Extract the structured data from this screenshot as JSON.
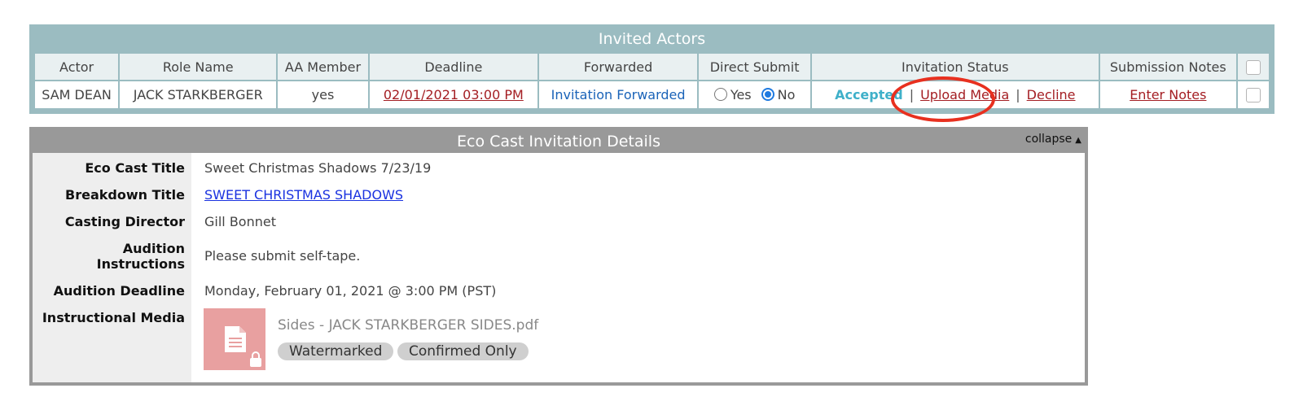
{
  "actors_panel": {
    "title": "Invited Actors",
    "headers": [
      "Actor",
      "Role Name",
      "AA Member",
      "Deadline",
      "Forwarded",
      "Direct Submit",
      "Invitation Status",
      "Submission Notes"
    ],
    "row": {
      "actor": "SAM DEAN",
      "role": "JACK STARKBERGER",
      "aa_member": "yes",
      "deadline": "02/01/2021 03:00 PM",
      "forwarded": "Invitation Forwarded",
      "direct_submit": {
        "yes_label": "Yes",
        "no_label": "No",
        "selected": "No"
      },
      "status": "Accepted",
      "upload_media": "Upload Media",
      "decline": "Decline",
      "separator": "|",
      "notes": "Enter Notes"
    }
  },
  "details_panel": {
    "title": "Eco Cast Invitation Details",
    "collapse_label": "collapse",
    "collapse_icon": "▲",
    "fields": {
      "eco_cast_title_label": "Eco Cast Title",
      "eco_cast_title_value": "Sweet Christmas Shadows 7/23/19",
      "breakdown_title_label": "Breakdown Title",
      "breakdown_title_value": "SWEET CHRISTMAS SHADOWS",
      "casting_director_label": "Casting Director",
      "casting_director_value": "Gill Bonnet",
      "audition_instructions_label_1": "Audition",
      "audition_instructions_label_2": "Instructions",
      "audition_instructions_value": "Please submit self-tape.",
      "audition_deadline_label": "Audition Deadline",
      "audition_deadline_value": "Monday, February 01, 2021 @ 3:00 PM (PST)",
      "instructional_media_label": "Instructional Media"
    },
    "media": {
      "file_name": "Sides - JACK STARKBERGER SIDES.pdf",
      "icon": "locked-document-icon",
      "badges": [
        "Watermarked",
        "Confirmed Only"
      ]
    }
  },
  "colors": {
    "actors_border": "#9bbcc1",
    "details_border": "#999999",
    "link_red": "#a41e23",
    "accepted": "#3fb0c9",
    "highlight": "#e8301f"
  }
}
